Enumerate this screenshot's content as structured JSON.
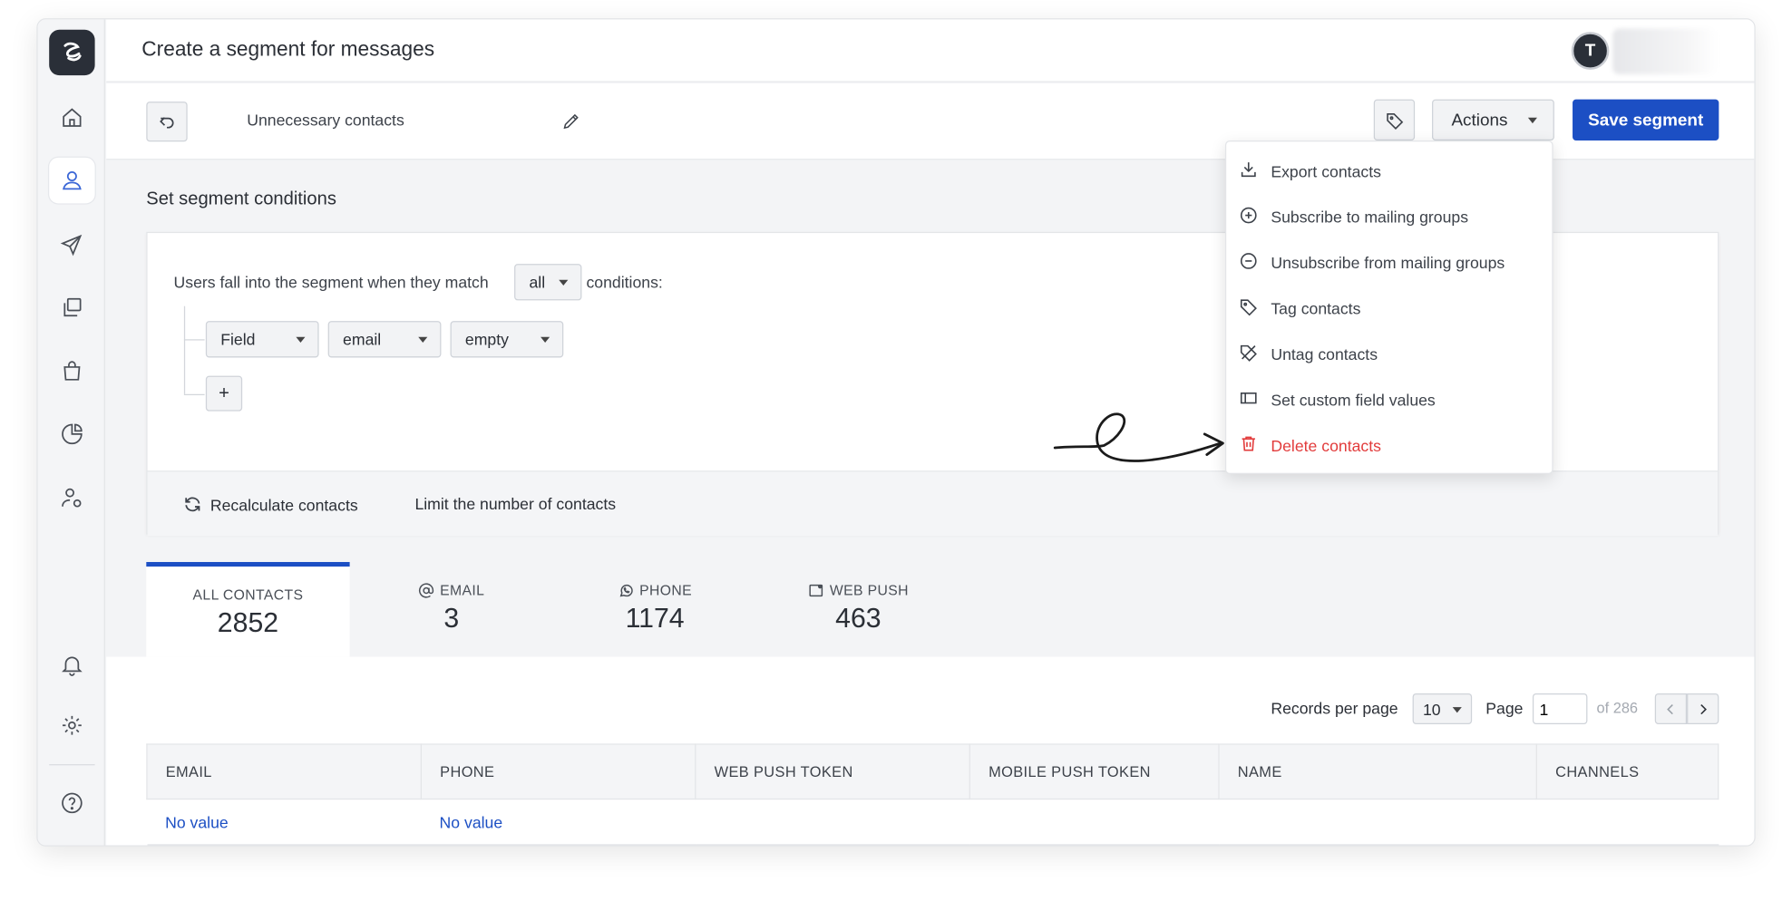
{
  "header": {
    "title": "Create a segment for messages",
    "avatar_initial": "T"
  },
  "toolbar": {
    "segment_name": "Unnecessary contacts",
    "actions_label": "Actions",
    "save_label": "Save segment"
  },
  "conditions": {
    "section_title": "Set segment conditions",
    "intro_text": "Users fall into the segment when they match",
    "match_value": "all",
    "suffix_text": "conditions:",
    "rule": {
      "type": "Field",
      "field": "email",
      "operator": "empty"
    },
    "add_label": "+",
    "recalculate_label": "Recalculate contacts",
    "limit_label": "Limit the number of contacts"
  },
  "tabs": [
    {
      "label": "ALL CONTACTS",
      "value": "2852"
    },
    {
      "label": "EMAIL",
      "value": "3"
    },
    {
      "label": "PHONE",
      "value": "1174"
    },
    {
      "label": "WEB PUSH",
      "value": "463"
    }
  ],
  "pagination": {
    "records_label": "Records per page",
    "per_page": "10",
    "page_label": "Page",
    "page": "1",
    "of_label": "of 286"
  },
  "table": {
    "columns": [
      "EMAIL",
      "PHONE",
      "WEB PUSH TOKEN",
      "MOBILE PUSH TOKEN",
      "NAME",
      "CHANNELS"
    ],
    "rows": [
      [
        "No value",
        "No value",
        "",
        "",
        "",
        ""
      ]
    ]
  },
  "actions_menu": [
    {
      "label": "Export contacts",
      "icon": "download-icon"
    },
    {
      "label": "Subscribe to mailing groups",
      "icon": "plus-circle-icon"
    },
    {
      "label": "Unsubscribe from mailing groups",
      "icon": "minus-circle-icon"
    },
    {
      "label": "Tag contacts",
      "icon": "tag-icon"
    },
    {
      "label": "Untag contacts",
      "icon": "untag-icon"
    },
    {
      "label": "Set custom field values",
      "icon": "field-icon"
    },
    {
      "label": "Delete contacts",
      "icon": "trash-icon"
    }
  ],
  "colors": {
    "accent": "#1c4fc4",
    "danger": "#e23b3b",
    "sidebar_active": "#3a66d6"
  }
}
